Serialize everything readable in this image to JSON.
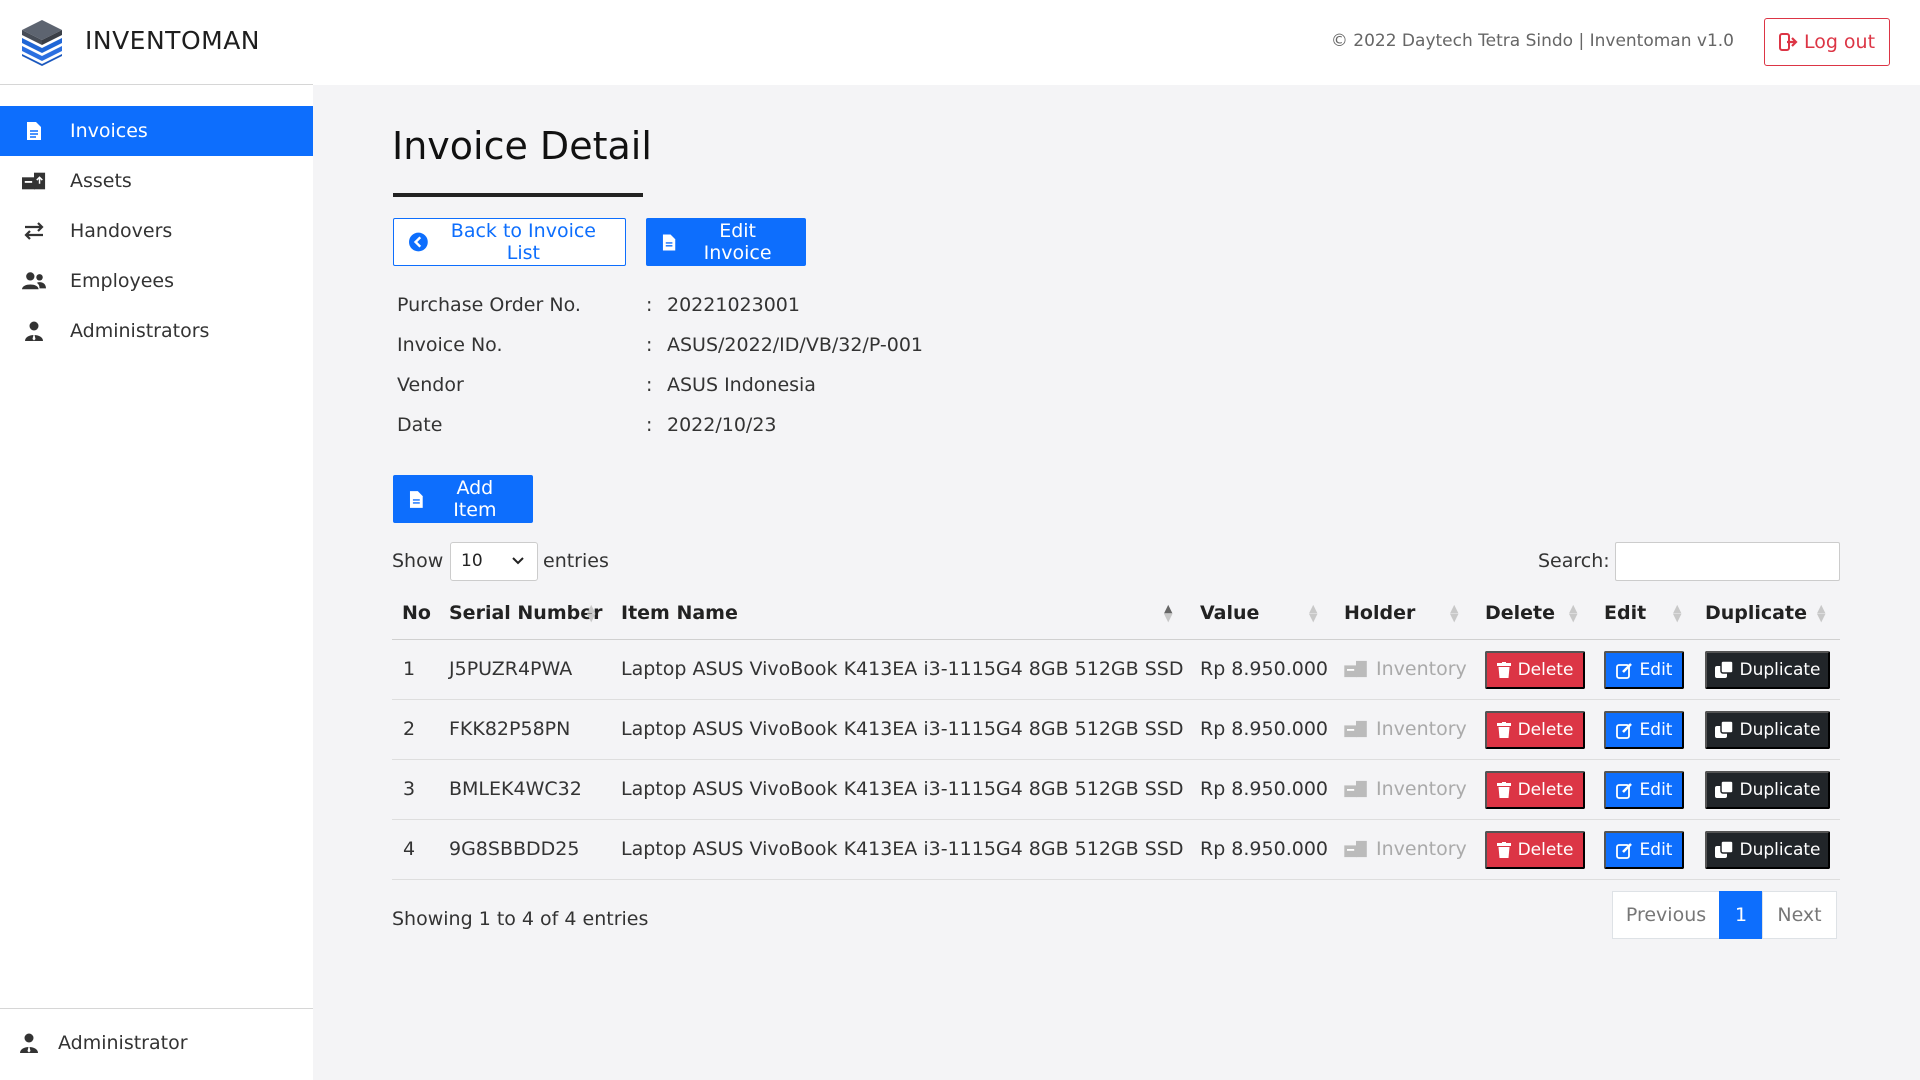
{
  "app": {
    "name": "INVENTOMAN",
    "copyright": "© 2022 Daytech Tetra Sindo | Inventoman v1.0",
    "logout_label": "Log out"
  },
  "sidebar": {
    "items": [
      {
        "label": "Invoices",
        "icon": "file-icon",
        "active": true
      },
      {
        "label": "Assets",
        "icon": "assets-icon",
        "active": false
      },
      {
        "label": "Handovers",
        "icon": "exchange-icon",
        "active": false
      },
      {
        "label": "Employees",
        "icon": "users-icon",
        "active": false
      },
      {
        "label": "Administrators",
        "icon": "user-tie-icon",
        "active": false
      }
    ],
    "user": "Administrator"
  },
  "page": {
    "title": "Invoice Detail",
    "back_label": "Back to Invoice List",
    "edit_label": "Edit Invoice",
    "add_item_label": "Add Item"
  },
  "invoice": {
    "fields": [
      {
        "key": "Purchase Order No.",
        "value": "20221023001"
      },
      {
        "key": "Invoice No.",
        "value": "ASUS/2022/ID/VB/32/P-001"
      },
      {
        "key": "Vendor",
        "value": "ASUS Indonesia"
      },
      {
        "key": "Date",
        "value": "2022/10/23"
      }
    ],
    "separator": ":"
  },
  "table_controls": {
    "show_label": "Show",
    "page_size": "10",
    "entries_label": "entries",
    "search_label": "Search:",
    "search_value": ""
  },
  "table": {
    "columns": [
      "No",
      "Serial Number",
      "Item Name",
      "Value",
      "Holder",
      "Delete",
      "Edit",
      "Duplicate"
    ],
    "rows": [
      {
        "no": "1",
        "serial": "J5PUZR4PWA",
        "item": "Laptop ASUS VivoBook K413EA i3-1115G4 8GB 512GB SSD",
        "value": "Rp 8.950.000",
        "holder": "Inventory",
        "delete": "Delete",
        "edit": "Edit",
        "duplicate": "Duplicate"
      },
      {
        "no": "2",
        "serial": "FKK82P58PN",
        "item": "Laptop ASUS VivoBook K413EA i3-1115G4 8GB 512GB SSD",
        "value": "Rp 8.950.000",
        "holder": "Inventory",
        "delete": "Delete",
        "edit": "Edit",
        "duplicate": "Duplicate"
      },
      {
        "no": "3",
        "serial": "BMLEK4WC32",
        "item": "Laptop ASUS VivoBook K413EA i3-1115G4 8GB 512GB SSD",
        "value": "Rp 8.950.000",
        "holder": "Inventory",
        "delete": "Delete",
        "edit": "Edit",
        "duplicate": "Duplicate"
      },
      {
        "no": "4",
        "serial": "9G8SBBDD25",
        "item": "Laptop ASUS VivoBook K413EA i3-1115G4 8GB 512GB SSD",
        "value": "Rp 8.950.000",
        "holder": "Inventory",
        "delete": "Delete",
        "edit": "Edit",
        "duplicate": "Duplicate"
      }
    ],
    "info": "Showing 1 to 4 of 4 entries"
  },
  "pagination": {
    "previous": "Previous",
    "current": "1",
    "next": "Next"
  },
  "colors": {
    "primary": "#0d6efd",
    "danger": "#dc3545",
    "dark": "#212529",
    "muted": "#aaaaaa"
  }
}
